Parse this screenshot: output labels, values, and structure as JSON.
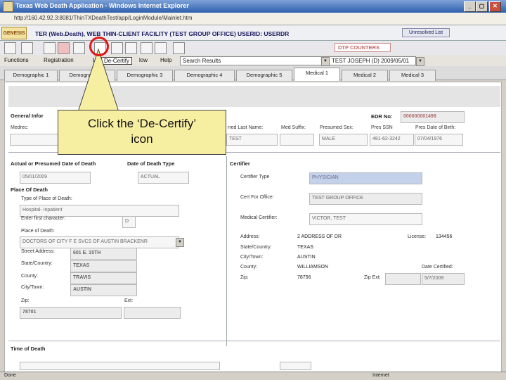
{
  "window": {
    "title": "Texas Web Death Application - Windows Internet Explorer",
    "url": "http://160.42.92.3:8081/ThinTXDeathTest/app/LoginModule/Mainlet.htm",
    "min": "_",
    "max": "▢",
    "close": "✕"
  },
  "banner": {
    "logo": "GENESIS",
    "text": "TER (Web.Death), WEB THIN-CLIENT FACILITY (TEST GROUP OFFICE) USERID: USERDR",
    "unresolved_button": "Unresolved List"
  },
  "toolbar": {
    "dtp_counter": "DTP COUNTERS"
  },
  "menus": [
    "Functions",
    "Registration",
    "Lt",
    "De-Certify",
    "low",
    "Help"
  ],
  "search": {
    "value": "Search Results",
    "patient": "TEST JOSEPH (D) 2009/05/01"
  },
  "tabs": [
    "Demographic 1",
    "Demographic 2",
    "Demographic 3",
    "Demographic 4",
    "Demographic 5",
    "Medical 1",
    "Medical 2",
    "Medical 3"
  ],
  "active_tab": "Medical 1",
  "general": {
    "heading": "General Infor",
    "medrec_label": "Medrec:",
    "edr_label": "EDR No:",
    "edr_value": "000000001498",
    "cols": [
      "rred Last Name:",
      "Med Suffix:",
      "Presumed Sex:",
      "Pres SSN",
      "Pres Date of Birth:"
    ],
    "vals": [
      "TEST",
      "",
      "MALE",
      "481-62-3242",
      "07/04/1976"
    ]
  },
  "death": {
    "heading": "Actual or Presumed Date of Death",
    "type_heading": "Date of Death Type",
    "date": "05/01/2009",
    "type": "ACTUAL",
    "place_heading": "Place Of Death",
    "type_place_label": "Type of Place of Death:",
    "type_place": "Hospital- Inpatient",
    "first_char_label": "Enter first character:",
    "first_char": "D",
    "place_label": "Place of Death:",
    "place": "DOCTORS OF CITY F E SVCS OF AUSTIN BRACKENR",
    "street_label": "Street Address:",
    "street": "601 E. 15TH",
    "state_label": "State/Country:",
    "state": "TEXAS",
    "county_label": "County:",
    "county": "TRAVIS",
    "city_label": "City/Town:",
    "city": "AUSTIN",
    "zip_label": "Zip:",
    "zip": "78701",
    "ext_label": "Ext:"
  },
  "certifier": {
    "heading": "Certifier",
    "type_label": "Certifier Type",
    "type": "PHYSICIAN",
    "office_label": "Cert For Office:",
    "office": "TEST GROUP OFFICE",
    "medical_label": "Medical Certifier:",
    "medical": "VICTOR, TEST",
    "address_label": "Address:",
    "address": "2 ADDRESS OF DR",
    "license_label": "License:",
    "license": "134456",
    "state_label": "State/Country:",
    "state": "TEXAS",
    "city_label": "City/Town:",
    "city": "AUSTIN",
    "county_label": "County:",
    "county": "WILLIAMSON",
    "date_label": "Date Certified:",
    "date": "5/7/2009",
    "zip_label": "Zip:",
    "zip": "78756",
    "zipext_label": "Zip Ext:"
  },
  "time_heading": "Time of Death",
  "status": {
    "left": "Done",
    "zone": "Internet"
  },
  "callout": {
    "line1": "Click the ‘De-Certify’",
    "line2": "icon"
  }
}
